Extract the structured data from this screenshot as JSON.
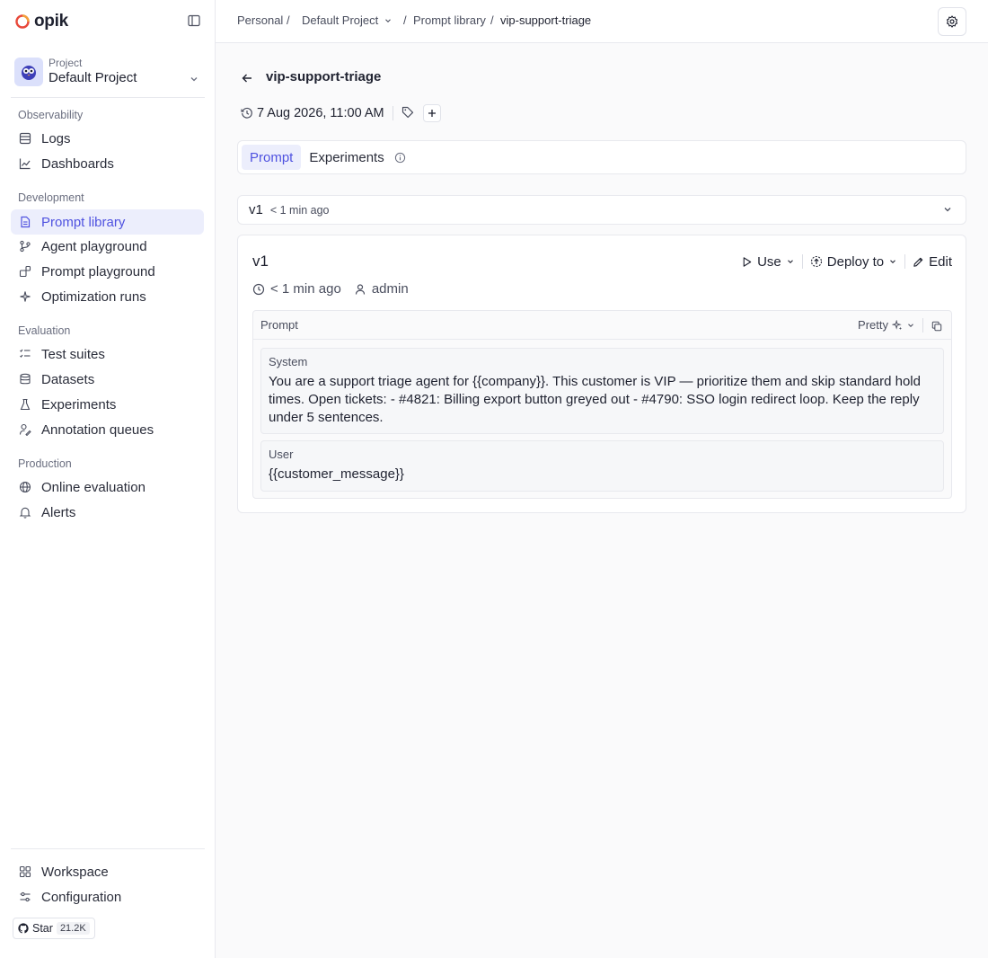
{
  "app": {
    "logo_text": "opik"
  },
  "sidebar": {
    "project_label": "Project",
    "project_name": "Default Project",
    "sections": {
      "observability": "Observability",
      "development": "Development",
      "evaluation": "Evaluation",
      "production": "Production"
    },
    "items": {
      "logs": "Logs",
      "dashboards": "Dashboards",
      "prompt_library": "Prompt library",
      "agent_playground": "Agent playground",
      "prompt_playground": "Prompt playground",
      "optimization_runs": "Optimization runs",
      "test_suites": "Test suites",
      "datasets": "Datasets",
      "experiments": "Experiments",
      "annotation_queues": "Annotation queues",
      "online_evaluation": "Online evaluation",
      "alerts": "Alerts",
      "workspace": "Workspace",
      "configuration": "Configuration"
    },
    "active_item": "prompt_library",
    "github": {
      "label": "Star",
      "count": "21.2K"
    }
  },
  "breadcrumb": {
    "workspace": "Personal",
    "project": "Default Project",
    "section": "Prompt library",
    "current": "vip-support-triage"
  },
  "page": {
    "title": "vip-support-triage",
    "date": "7 Aug 2026, 11:00 AM"
  },
  "tabs": {
    "prompt": "Prompt",
    "experiments": "Experiments",
    "active": "prompt"
  },
  "version_selector": {
    "version": "v1",
    "time": "< 1 min ago"
  },
  "version_card": {
    "version": "v1",
    "time": "< 1 min ago",
    "author": "admin",
    "actions": {
      "use": "Use",
      "deploy": "Deploy to",
      "edit": "Edit"
    },
    "prompt_header": "Prompt",
    "format": "Pretty",
    "messages": [
      {
        "role": "System",
        "content": "You are a support triage agent for {{company}}. This customer is VIP — prioritize them and skip standard hold times. Open tickets: - #4821: Billing export button greyed out - #4790: SSO login redirect loop. Keep the reply under 5 sentences."
      },
      {
        "role": "User",
        "content": "{{customer_message}}"
      }
    ]
  },
  "colors": {
    "accent": "#4f52e0",
    "accent_bg": "#eceefc",
    "logo_ring": "#e8493b"
  }
}
